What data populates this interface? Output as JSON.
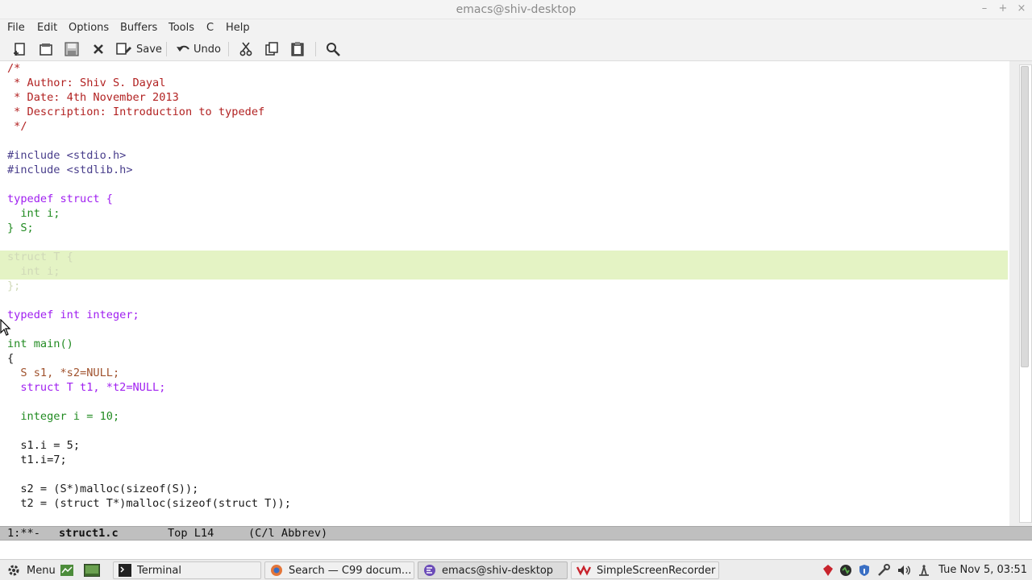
{
  "window": {
    "title": "emacs@shiv-desktop",
    "controls": [
      "minimize",
      "maximize",
      "close"
    ]
  },
  "menu": {
    "items": [
      "File",
      "Edit",
      "Options",
      "Buffers",
      "Tools",
      "C",
      "Help"
    ]
  },
  "toolbar": {
    "save_label": "Save",
    "undo_label": "Undo",
    "icons": [
      "new-file-icon",
      "open-folder-icon",
      "save-disk-icon",
      "close-x-icon",
      "save-as-icon",
      "undo-icon",
      "cut-icon",
      "copy-icon",
      "paste-icon",
      "search-icon"
    ]
  },
  "editor": {
    "lines": [
      "/*",
      " * Author: Shiv S. Dayal",
      " * Date: 4th November 2013",
      " * Description: Introduction to typedef",
      " */",
      "",
      "#include <stdio.h>",
      "#include <stdlib.h>",
      "",
      "typedef struct {",
      "  int i;",
      "} S;",
      "",
      "struct T {",
      "  int i;",
      "};",
      "",
      "typedef int integer;",
      "",
      "int main()",
      "{",
      "  S s1, *s2=NULL;",
      "  struct T t1, *t2=NULL;",
      "",
      "  integer i = 10;",
      "",
      "  s1.i = 5;",
      "  t1.i=7;",
      "",
      "  s2 = (S*)malloc(sizeof(S));",
      "  t2 = (struct T*)malloc(sizeof(struct T));"
    ],
    "highlighted_lines": [
      14,
      15,
      16
    ]
  },
  "modeline": {
    "status": "1:**-",
    "buffer_name": "struct1.c",
    "position": "Top L14",
    "modes": "(C/l Abbrev)"
  },
  "taskbar": {
    "menu_label": "Menu",
    "tasks": [
      {
        "label": "Terminal",
        "icon": "terminal-icon",
        "active": false
      },
      {
        "label": "Search — C99 docum...",
        "icon": "browser-icon",
        "active": false
      },
      {
        "label": "emacs@shiv-desktop",
        "icon": "emacs-icon",
        "active": true
      },
      {
        "label": "SimpleScreenRecorder",
        "icon": "recorder-icon",
        "active": false
      }
    ],
    "tray_icons": [
      "ruby-icon",
      "screen-recorder-tray-icon",
      "info-shield-icon",
      "tools-icon",
      "volume-icon",
      "network-icon"
    ],
    "clock": "Tue Nov  5, 03:51"
  },
  "colors": {
    "comment": "#b22222",
    "preprocessor": "#483d8b",
    "keyword": "#a020f0",
    "type": "#228b22",
    "variable": "#a0522d",
    "function": "#0000ff",
    "constant": "#008b8b",
    "region_highlight": "#e4f3c4",
    "modeline_bg": "#bfbfbf"
  }
}
